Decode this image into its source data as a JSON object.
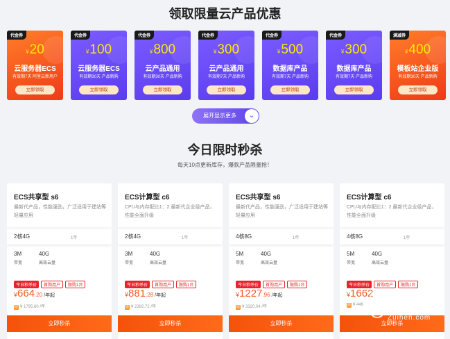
{
  "section1": {
    "title": "领取限量云产品优惠"
  },
  "coupons": [
    {
      "tag": "代金券",
      "currency": "¥",
      "amount": "20",
      "name": "云服务器ECS",
      "desc": "有效期7天 阿里云新用户",
      "button": "立即领取"
    },
    {
      "tag": "代金券",
      "currency": "¥",
      "amount": "100",
      "name": "云服务器ECS",
      "desc": "有效期30天 产品新购",
      "button": "立即领取"
    },
    {
      "tag": "代金券",
      "currency": "¥",
      "amount": "800",
      "name": "云产品通用",
      "desc": "有效期30天 产品新购",
      "button": "立即领取"
    },
    {
      "tag": "代金券",
      "currency": "¥",
      "amount": "300",
      "name": "云产品通用",
      "desc": "有效期7天 产品新购",
      "button": "立即领取"
    },
    {
      "tag": "代金券",
      "currency": "¥",
      "amount": "500",
      "name": "数据库产品",
      "desc": "有效期7天 产品新购",
      "button": "立即领取"
    },
    {
      "tag": "代金券",
      "currency": "¥",
      "amount": "300",
      "name": "数据库产品",
      "desc": "有效期7天 产品新购",
      "button": "立即领取"
    },
    {
      "tag": "满减券",
      "currency": "¥",
      "amount": "400",
      "name": "模板站企业版",
      "desc": "有效期30天 产品新购",
      "button": "立即领取"
    }
  ],
  "expand_button": "展开显示更多",
  "section2": {
    "title": "今日限时秒杀",
    "subtitle": "每天10点更新库存，爆款产品限量抢！"
  },
  "products": [
    {
      "name": "ECS共享型 s6",
      "desc": "最新代产品，性能强劲，广泛适用于建站等轻量应用",
      "cores": "2核4G",
      "term": "1年",
      "bandwidth": "3M",
      "bandwidth_label": "带宽",
      "disk": "40G",
      "disk_label": "高效云盘",
      "badges": [
        "今日秒杀价",
        "首购用户",
        "限购1台"
      ],
      "currency": "¥",
      "price": "664",
      "price_dec": ".20",
      "unit": "/年起",
      "orig": "¥ 1795.80 /年",
      "button": "立即秒杀"
    },
    {
      "name": "ECS计算型 c6",
      "desc": "CPU与内存配比1：2 最新代企业级产品，性能全面升级",
      "cores": "2核4G",
      "term": "1年",
      "bandwidth": "3M",
      "bandwidth_label": "带宽",
      "disk": "40G",
      "disk_label": "高效云盘",
      "badges": [
        "今日秒杀价",
        "首购用户",
        "限购1台"
      ],
      "currency": "¥",
      "price": "881",
      "price_dec": ".28",
      "unit": "/年起",
      "orig": "¥ 2382.72 /年",
      "button": "立即秒杀"
    },
    {
      "name": "ECS共享型 s6",
      "desc": "最新代产品，性能强劲，广泛适用于建站等轻量应用",
      "cores": "4核8G",
      "term": "1年",
      "bandwidth": "5M",
      "bandwidth_label": "带宽",
      "disk": "40G",
      "disk_label": "高效云盘",
      "badges": [
        "今日秒杀价",
        "首购用户",
        "限购1台"
      ],
      "currency": "¥",
      "price": "1227",
      "price_dec": ".96",
      "unit": "/年起",
      "orig": "¥ 3320.04 /年",
      "button": "立即秒杀"
    },
    {
      "name": "ECS计算型 c6",
      "desc": "CPU与内存配比1：2 最新代企业级产品，性能全面升级",
      "cores": "4核8G",
      "term": "1年",
      "bandwidth": "5M",
      "bandwidth_label": "带宽",
      "disk": "40G",
      "disk_label": "高效云盘",
      "badges": [
        "今日秒杀价",
        "首购用户",
        "限购1台"
      ],
      "currency": "¥",
      "price": "1662",
      "price_dec": "",
      "unit": "",
      "orig": "¥ 449",
      "button": "立即秒杀"
    }
  ],
  "watermark": {
    "text": "足痕",
    "domain": "Zuihen.com"
  },
  "colors": {
    "accent_orange": "#f5520c",
    "accent_purple": "#6a4ff0",
    "price": "#f15a22",
    "badge_red": "#e8232b"
  },
  "icons": {
    "expand": "chevron-down-icon",
    "orig_price": "orig-price-icon"
  }
}
